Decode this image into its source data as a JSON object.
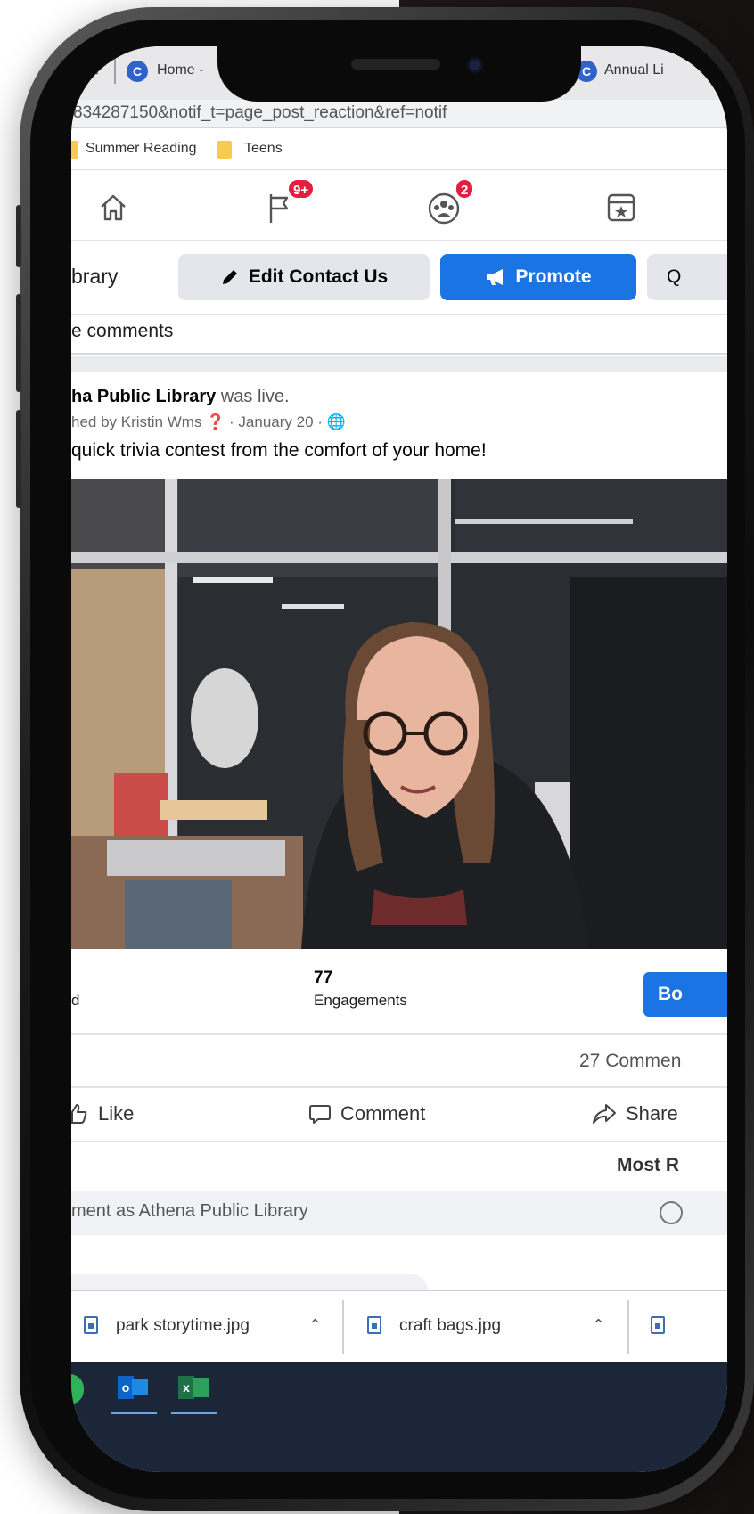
{
  "browser": {
    "tabs": [
      {
        "label": "Home -",
        "icon": "chrome-icon"
      },
      {
        "label": "Annual Li",
        "icon": "chrome-icon"
      }
    ],
    "url": "834287150&notif_t=page_post_reaction&ref=notif",
    "bookmarks": [
      "Summer Reading",
      "Teens"
    ]
  },
  "fb_nav": {
    "notifications_badge": "9+",
    "groups_badge": "2"
  },
  "page_header": {
    "name": "brary",
    "edit_label": "Edit Contact Us",
    "promote_label": "Promote",
    "search_label": "Q"
  },
  "filter_label": "e comments",
  "post": {
    "author": "ha Public Library",
    "author_suffix": " was live.",
    "meta": "hed by Kristin Wms ❓ · January 20 · 🌐",
    "text": "quick trivia contest from the comfort of your home!",
    "stat_left": "d",
    "engagements_value": "77",
    "engagements_label": "Engagements",
    "boost_label": "Bo",
    "comment_count": "27 Commen",
    "like_label": "Like",
    "comment_label": "Comment",
    "share_label": "Share",
    "sort_label": "Most R",
    "comment_placeholder": "ment as Athena Public Library"
  },
  "downloads": [
    {
      "name": "park storytime.jpg"
    },
    {
      "name": "craft bags.jpg"
    }
  ],
  "taskbar": {
    "apps": [
      "outlook-icon",
      "excel-icon"
    ]
  },
  "colors": {
    "fb_blue": "#1b74e4",
    "badge_red": "#e41e3f",
    "taskbar": "#1b2638"
  }
}
